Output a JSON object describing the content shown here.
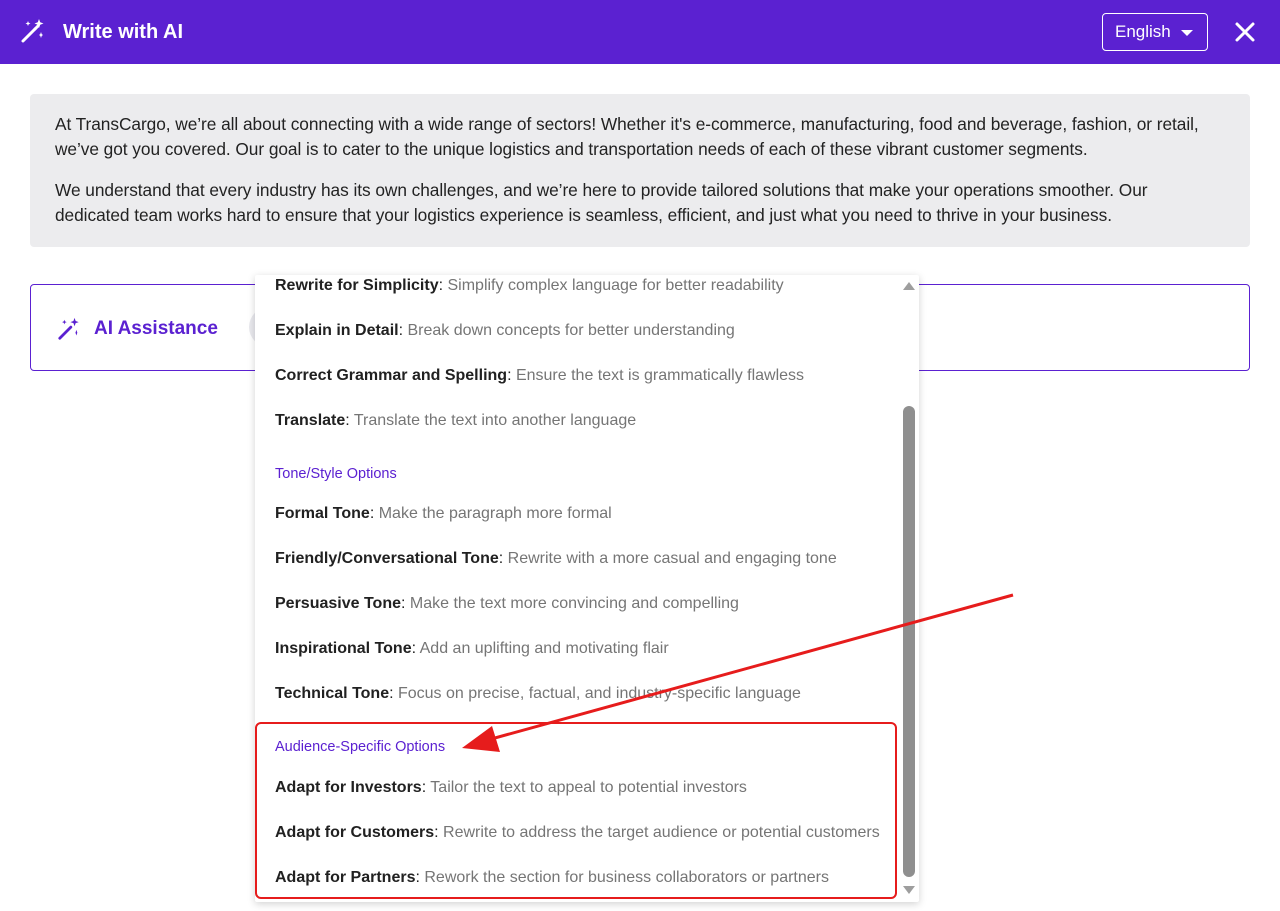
{
  "header": {
    "title": "Write with AI",
    "language": "English",
    "icons": {
      "wand": "magic-wand-icon",
      "close": "close-icon",
      "caret": "chevron-down-icon"
    }
  },
  "content": {
    "paragraphs": [
      "At TransCargo, we’re all about connecting with a wide range of sectors! Whether it's e-commerce, manufacturing, food and beverage, fashion, or retail, we’ve got you covered. Our goal is to cater to the unique logistics and transportation needs of each of these vibrant customer segments.",
      "We understand that every industry has its own challenges, and we’re here to provide tailored solutions that make your operations smoother. Our dedicated team works hard to ensure that your logistics experience is seamless, efficient, and just what you need to thrive in your business."
    ]
  },
  "assist": {
    "label": "AI Assistance"
  },
  "menu": {
    "items_top": [
      {
        "name": "Rewrite for Simplicity",
        "desc": "Simplify complex language for better readability"
      },
      {
        "name": "Explain in Detail",
        "desc": "Break down concepts for better understanding"
      },
      {
        "name": "Correct Grammar and Spelling",
        "desc": "Ensure the text is grammatically flawless"
      },
      {
        "name": "Translate",
        "desc": "Translate the text into another language"
      }
    ],
    "tone_heading": "Tone/Style Options",
    "tone_items": [
      {
        "name": "Formal Tone",
        "desc": "Make the paragraph more formal"
      },
      {
        "name": "Friendly/Conversational Tone",
        "desc": "Rewrite with a more casual and engaging tone"
      },
      {
        "name": "Persuasive Tone",
        "desc": "Make the text more convincing and compelling"
      },
      {
        "name": "Inspirational Tone",
        "desc": "Add an uplifting and motivating flair"
      },
      {
        "name": "Technical Tone",
        "desc": "Focus on precise, factual, and industry-specific language"
      }
    ],
    "audience_heading": "Audience-Specific Options",
    "audience_items": [
      {
        "name": "Adapt for Investors",
        "desc": "Tailor the text to appeal to potential investors"
      },
      {
        "name": "Adapt for Customers",
        "desc": "Rewrite to address the target audience or potential customers"
      },
      {
        "name": "Adapt for Partners",
        "desc": "Rework the section for business collaborators or partners"
      }
    ],
    "separator": ": "
  },
  "colors": {
    "brand": "#5b21d1",
    "annotation": "#e61c1c",
    "panel": "#ececee"
  }
}
